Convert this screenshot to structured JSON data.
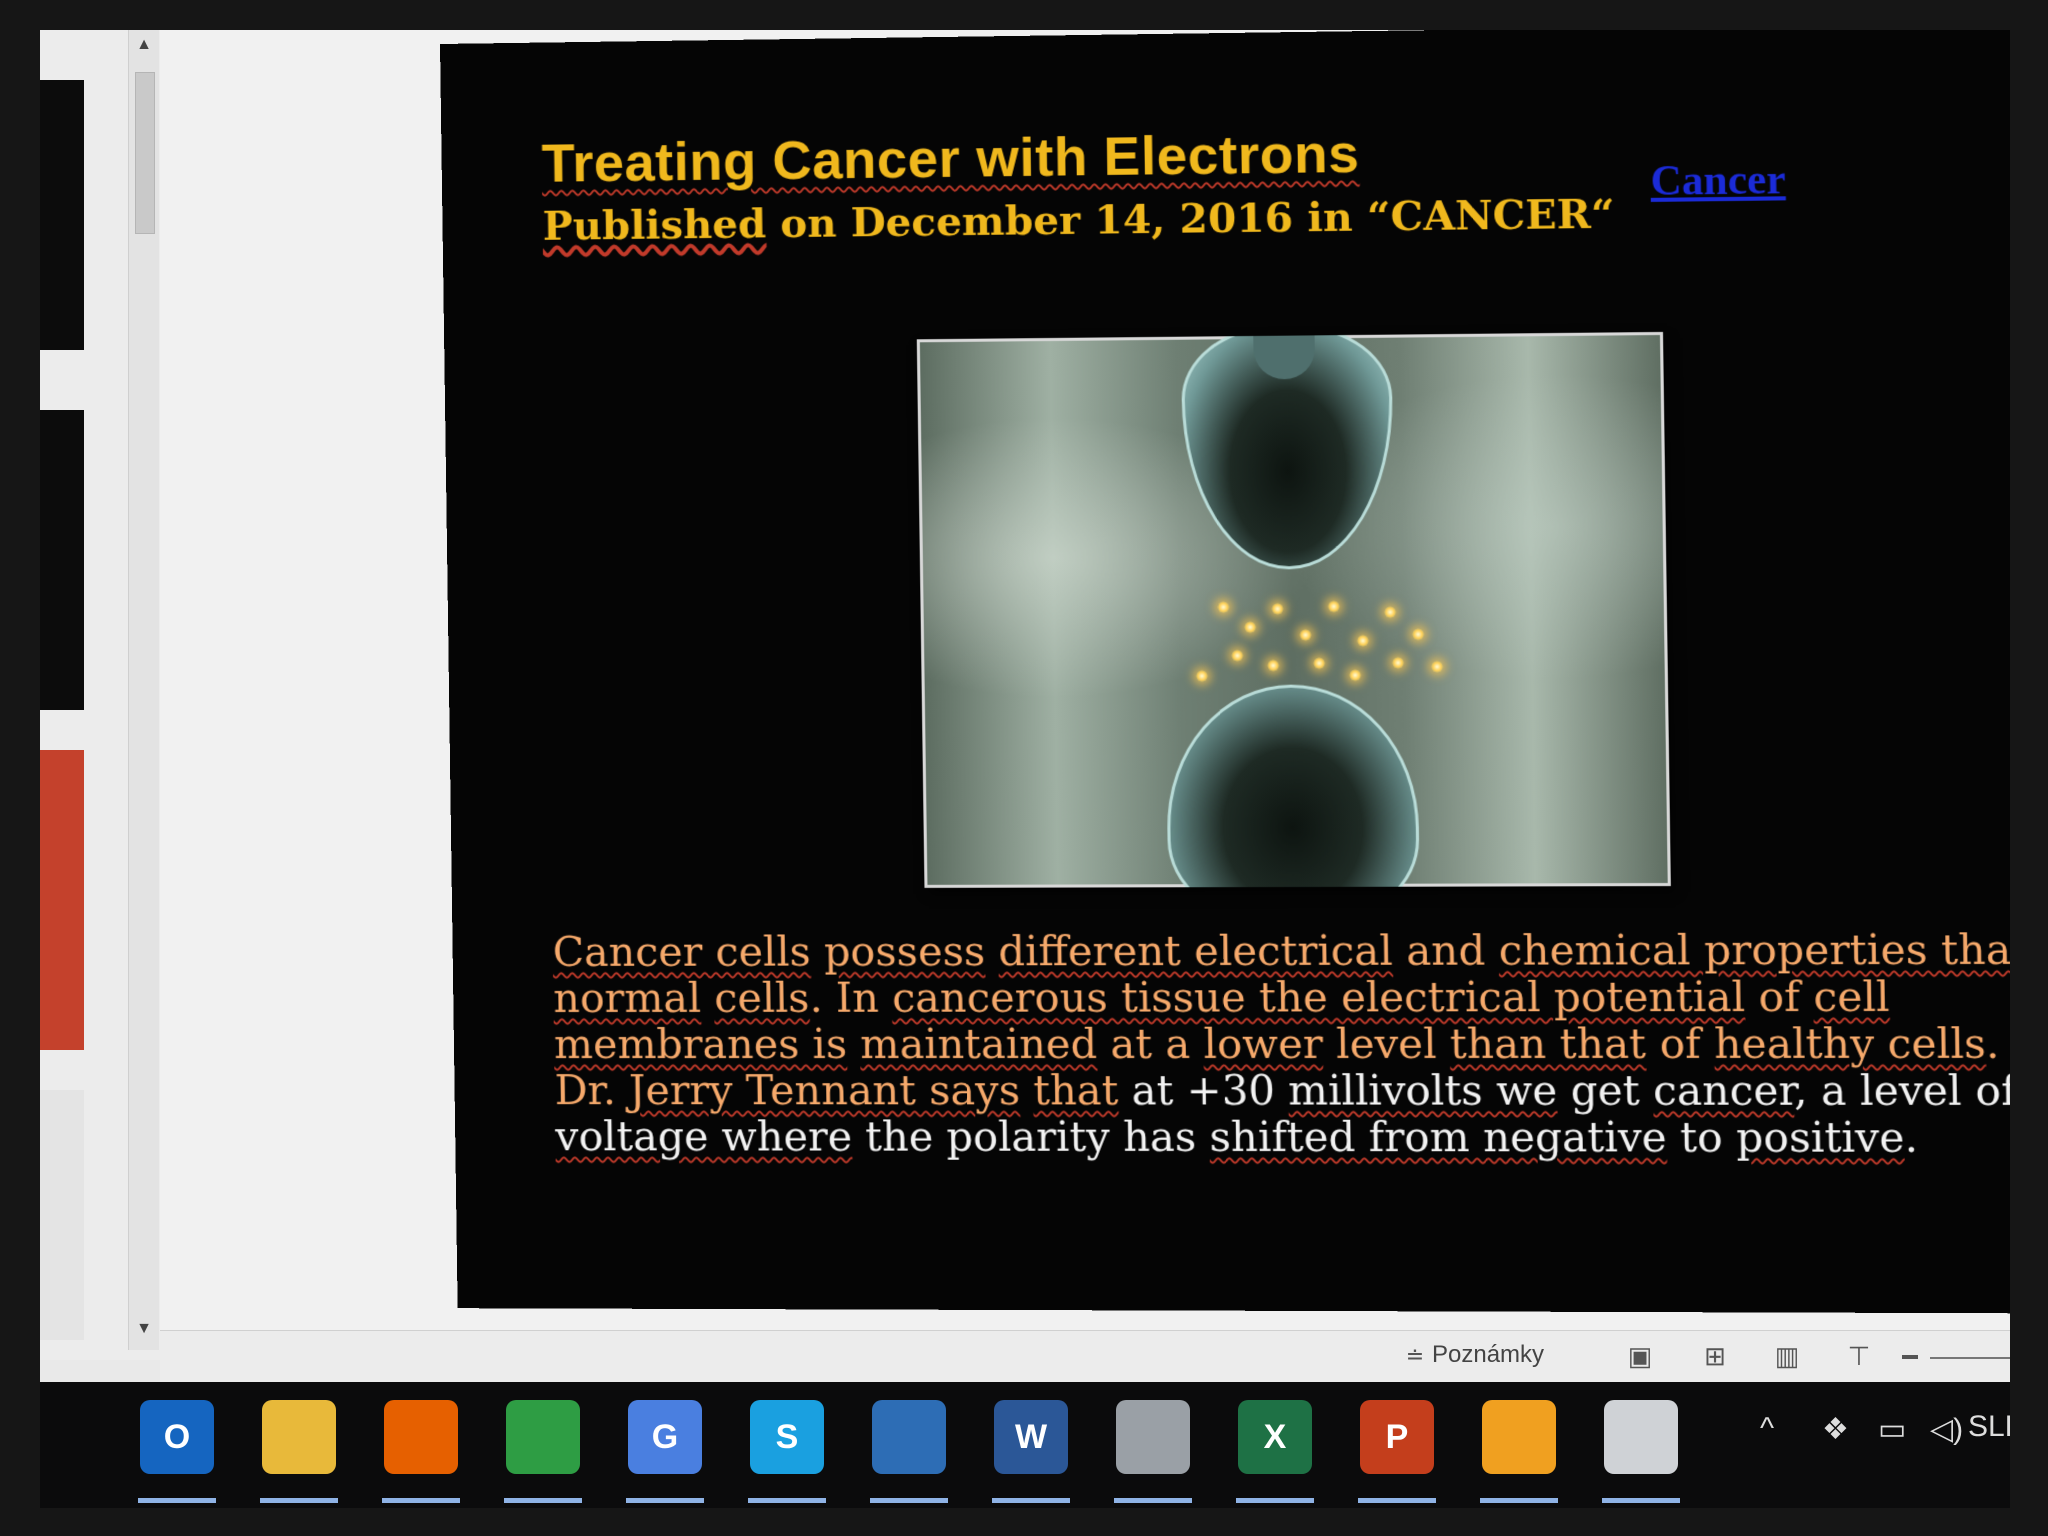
{
  "slide": {
    "title": "Treating Cancer with Electrons",
    "subtitle_prefix": "Published",
    "subtitle_rest": " on December 14, 2016 in “CANCER“",
    "category_link": "Cancer",
    "body": [
      {
        "t": "Cancer cells",
        "c": "orange",
        "u": true
      },
      {
        "t": " ",
        "c": "orange",
        "u": false
      },
      {
        "t": "possess",
        "c": "orange",
        "u": true
      },
      {
        "t": " ",
        "c": "orange",
        "u": false
      },
      {
        "t": "different electrical",
        "c": "orange",
        "u": true
      },
      {
        "t": " and ",
        "c": "orange",
        "u": false
      },
      {
        "t": "chemical properties than normal",
        "c": "orange",
        "u": true
      },
      {
        "t": " ",
        "c": "orange",
        "u": false
      },
      {
        "t": "cells",
        "c": "orange",
        "u": true
      },
      {
        "t": ". In ",
        "c": "orange",
        "u": false
      },
      {
        "t": "cancerous tissue the electrical potential",
        "c": "orange",
        "u": true
      },
      {
        "t": " of ",
        "c": "orange",
        "u": false
      },
      {
        "t": "cell membranes is",
        "c": "orange",
        "u": true
      },
      {
        "t": " ",
        "c": "orange",
        "u": false
      },
      {
        "t": "maintained",
        "c": "orange",
        "u": true
      },
      {
        "t": " at a ",
        "c": "orange",
        "u": false
      },
      {
        "t": "lower",
        "c": "orange",
        "u": true
      },
      {
        "t": " level ",
        "c": "orange",
        "u": false
      },
      {
        "t": "than that",
        "c": "orange",
        "u": true
      },
      {
        "t": " of ",
        "c": "orange",
        "u": false
      },
      {
        "t": "healthy cells",
        "c": "orange",
        "u": true
      },
      {
        "t": ". Dr. ",
        "c": "orange",
        "u": false
      },
      {
        "t": "Jerry Tennant says",
        "c": "orange",
        "u": true
      },
      {
        "t": " ",
        "c": "orange",
        "u": false
      },
      {
        "t": "that",
        "c": "orange",
        "u": true
      },
      {
        "t": " at +30 ",
        "c": "white",
        "u": false
      },
      {
        "t": "millivolts we",
        "c": "white",
        "u": true
      },
      {
        "t": " get ",
        "c": "white",
        "u": false
      },
      {
        "t": "cancer",
        "c": "white",
        "u": true
      },
      {
        "t": ", a level of ",
        "c": "white",
        "u": false
      },
      {
        "t": "voltage where",
        "c": "white",
        "u": true
      },
      {
        "t": " the polarity has ",
        "c": "white",
        "u": false
      },
      {
        "t": "shifted from negative",
        "c": "white",
        "u": true
      },
      {
        "t": " to ",
        "c": "white",
        "u": false
      },
      {
        "t": "positive",
        "c": "white",
        "u": true
      },
      {
        "t": ".",
        "c": "white",
        "u": false
      }
    ]
  },
  "statusbar": {
    "notes_label": "Poznámky"
  },
  "taskbar": {
    "apps": [
      {
        "name": "outlook",
        "label": "O",
        "color": "#1565c0"
      },
      {
        "name": "file-explorer",
        "label": "",
        "color": "#e8b93a"
      },
      {
        "name": "firefox",
        "label": "",
        "color": "#e66000"
      },
      {
        "name": "chrome",
        "label": "",
        "color": "#2e9d44"
      },
      {
        "name": "google-translate",
        "label": "G",
        "color": "#4a7fe0"
      },
      {
        "name": "skype",
        "label": "S",
        "color": "#1aa0e0"
      },
      {
        "name": "thunderbird",
        "label": "",
        "color": "#2d6db5"
      },
      {
        "name": "word",
        "label": "W",
        "color": "#2b5797"
      },
      {
        "name": "snipping-tool",
        "label": "",
        "color": "#9aa0a6"
      },
      {
        "name": "excel",
        "label": "X",
        "color": "#1e7145"
      },
      {
        "name": "powerpoint",
        "label": "P",
        "color": "#c43e1c"
      },
      {
        "name": "pinwheel-app",
        "label": "",
        "color": "#f0a020"
      },
      {
        "name": "movie-maker",
        "label": "",
        "color": "#cfd2d6"
      }
    ],
    "language": "SLK"
  }
}
